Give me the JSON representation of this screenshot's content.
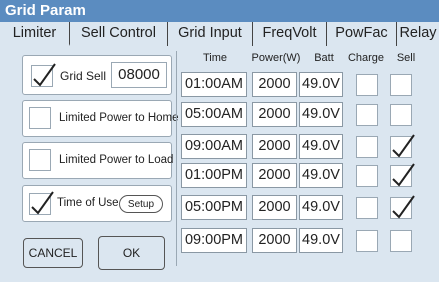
{
  "window": {
    "title": "Grid Param"
  },
  "tabs": [
    {
      "label": "Limiter",
      "active": true
    },
    {
      "label": "Sell Control",
      "active": false
    },
    {
      "label": "Grid Input",
      "active": false
    },
    {
      "label": "FreqVolt",
      "active": false
    },
    {
      "label": "PowFac",
      "active": false
    },
    {
      "label": "Relay",
      "active": false
    }
  ],
  "options": {
    "grid_sell": {
      "label": "Grid Sell",
      "checked": true,
      "value": "08000"
    },
    "limited_home": {
      "label": "Limited Power to Home",
      "checked": false
    },
    "limited_load": {
      "label": "Limited Power to Load",
      "checked": false
    },
    "time_of_use": {
      "label": "Time of Use",
      "checked": true,
      "setup_label": "Setup"
    }
  },
  "buttons": {
    "cancel": "CANCEL",
    "ok": "OK"
  },
  "table": {
    "headers": [
      "Time",
      "Power(W)",
      "Batt",
      "Charge",
      "Sell"
    ],
    "rows": [
      {
        "time": "01:00AM",
        "power": "2000",
        "batt": "49.0V",
        "charge": false,
        "sell": false
      },
      {
        "time": "05:00AM",
        "power": "2000",
        "batt": "49.0V",
        "charge": false,
        "sell": false
      },
      {
        "time": "09:00AM",
        "power": "2000",
        "batt": "49.0V",
        "charge": false,
        "sell": true
      },
      {
        "time": "01:00PM",
        "power": "2000",
        "batt": "49.0V",
        "charge": false,
        "sell": true
      },
      {
        "time": "05:00PM",
        "power": "2000",
        "batt": "49.0V",
        "charge": false,
        "sell": true
      },
      {
        "time": "09:00PM",
        "power": "2000",
        "batt": "49.0V",
        "charge": false,
        "sell": false
      }
    ]
  }
}
